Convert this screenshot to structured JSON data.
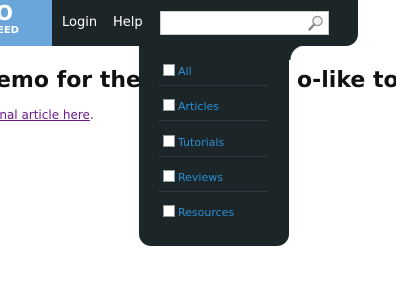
{
  "logo": {
    "big": "O",
    "small": "EED"
  },
  "nav": {
    "login": "Login",
    "help": "Help"
  },
  "search": {
    "placeholder": "",
    "value": "",
    "icon": "magnifier-icon"
  },
  "dropdown": {
    "items": [
      {
        "label": "All",
        "checked": false
      },
      {
        "label": "Articles",
        "checked": false
      },
      {
        "label": "Tutorials",
        "checked": false
      },
      {
        "label": "Reviews",
        "checked": false
      },
      {
        "label": "Resources",
        "checked": false
      }
    ]
  },
  "article": {
    "title_start": "emo for the '",
    "title_end": "o-like top",
    "link_text": "inal article here",
    "after_link": "."
  },
  "colors": {
    "bar": "#1c2628",
    "logo": "#6aa6d9",
    "dropdown_link": "#2b8fd6",
    "visited_link": "#6a1a8a"
  }
}
